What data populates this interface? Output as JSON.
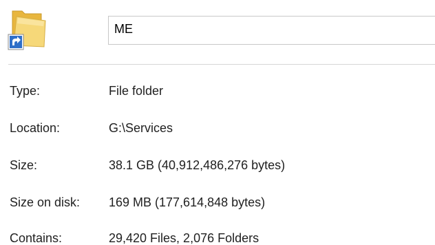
{
  "header": {
    "folder_icon": "folder-shortcut-icon",
    "name_value": "ME"
  },
  "properties": [
    {
      "label": "Type:",
      "value": "File folder"
    },
    {
      "label": "Location:",
      "value": "G:\\Services"
    },
    {
      "label": "Size:",
      "value": "38.1 GB (40,912,486,276 bytes)"
    },
    {
      "label": "Size on disk:",
      "value": "169 MB (177,614,848 bytes)"
    },
    {
      "label": "Contains:",
      "value": "29,420 Files, 2,076 Folders"
    }
  ],
  "colors": {
    "folder_yellow": "#f3d16b",
    "shortcut_blue": "#2f6fc8",
    "divider": "#d6d6d6"
  }
}
